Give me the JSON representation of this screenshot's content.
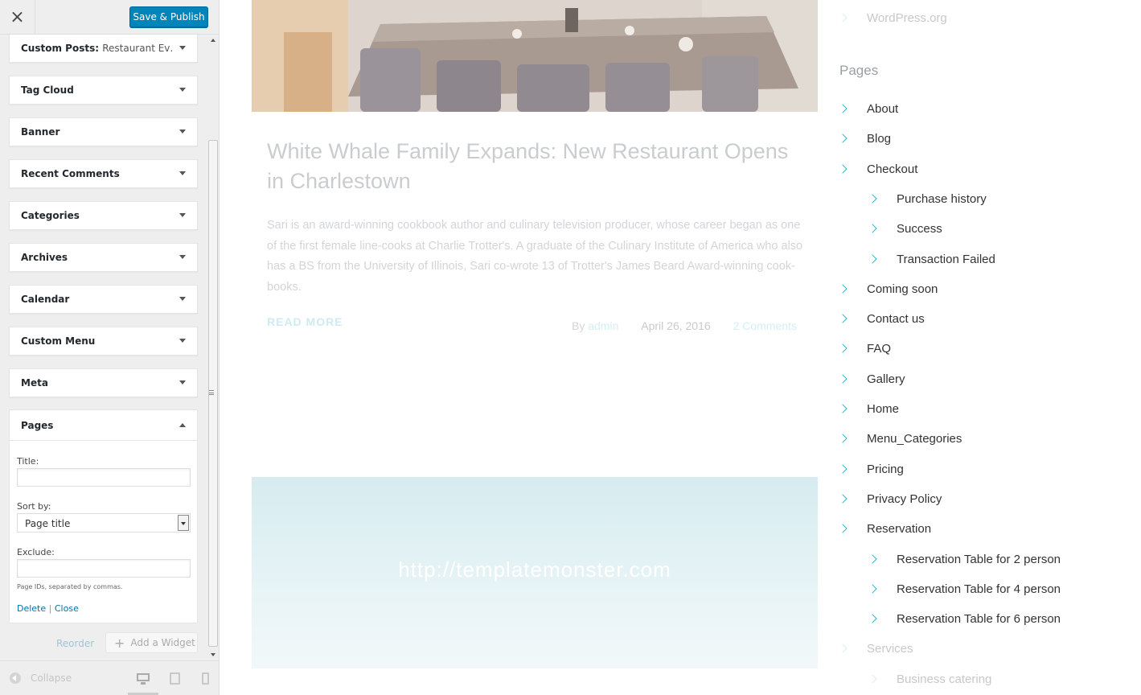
{
  "customizer": {
    "close_label": "×",
    "save_label": "Save & Publish",
    "widgets": [
      {
        "title_label": "Custom Posts:",
        "title_instance": "Restaurant Ev…"
      },
      {
        "title_label": "Tag Cloud"
      },
      {
        "title_label": "Banner"
      },
      {
        "title_label": "Recent Comments"
      },
      {
        "title_label": "Categories"
      },
      {
        "title_label": "Archives"
      },
      {
        "title_label": "Calendar"
      },
      {
        "title_label": "Custom Menu"
      },
      {
        "title_label": "Meta"
      }
    ],
    "pages_widget": {
      "title": "Pages",
      "title_field_label": "Title:",
      "title_field_value": "",
      "sort_label": "Sort by:",
      "sort_value": "Page title",
      "exclude_label": "Exclude:",
      "exclude_value": "",
      "exclude_hint": "Page IDs, separated by commas.",
      "delete_label": "Delete",
      "separator": "|",
      "close_label": "Close"
    },
    "reorder_label": "Reorder",
    "add_widget_label": "Add a Widget",
    "add_widget_icon": "+",
    "collapse_label": "Collapse",
    "devices": [
      "desktop-icon",
      "tablet-icon",
      "mobile-icon"
    ]
  },
  "preview": {
    "post": {
      "title": "White Whale Family Expands: New Restaurant Opens in Charlestown",
      "excerpt": "Sari is an award-winning cookbook author and culinary television producer, whose career began as one of the first female line-cooks at Charlie Trotter's. A graduate of the Culinary Institute of America who also has a BS from the University of Illinois, Sari co-wrote 13 of Trotter's James Beard Award-winning cook-books.",
      "read_more": "READ MORE",
      "by_label": "By",
      "author": "admin",
      "date": "April 26, 2016",
      "comments": "2 Comments"
    },
    "banner_url": "http://templatemonster.com",
    "sidebar": {
      "top_link": "WordPress.org",
      "pages_heading": "Pages",
      "pages": [
        {
          "label": "About",
          "level": 0
        },
        {
          "label": "Blog",
          "level": 0
        },
        {
          "label": "Checkout",
          "level": 0
        },
        {
          "label": "Purchase history",
          "level": 1
        },
        {
          "label": "Success",
          "level": 1
        },
        {
          "label": "Transaction Failed",
          "level": 1
        },
        {
          "label": "Coming soon",
          "level": 0
        },
        {
          "label": "Contact us",
          "level": 0
        },
        {
          "label": "FAQ",
          "level": 0
        },
        {
          "label": "Gallery",
          "level": 0
        },
        {
          "label": "Home",
          "level": 0
        },
        {
          "label": "Menu_Categories",
          "level": 0
        },
        {
          "label": "Pricing",
          "level": 0
        },
        {
          "label": "Privacy Policy",
          "level": 0
        },
        {
          "label": "Reservation",
          "level": 0
        },
        {
          "label": "Reservation Table for 2 person",
          "level": 1
        },
        {
          "label": "Reservation Table for 4 person",
          "level": 1
        },
        {
          "label": "Reservation Table for 6 person",
          "level": 1
        },
        {
          "label": "Services",
          "level": 0
        },
        {
          "label": "Business catering",
          "level": 1
        }
      ]
    }
  },
  "colors": {
    "accent": "#0085ba",
    "chevron": "#27b7c8",
    "link": "#0073aa"
  }
}
